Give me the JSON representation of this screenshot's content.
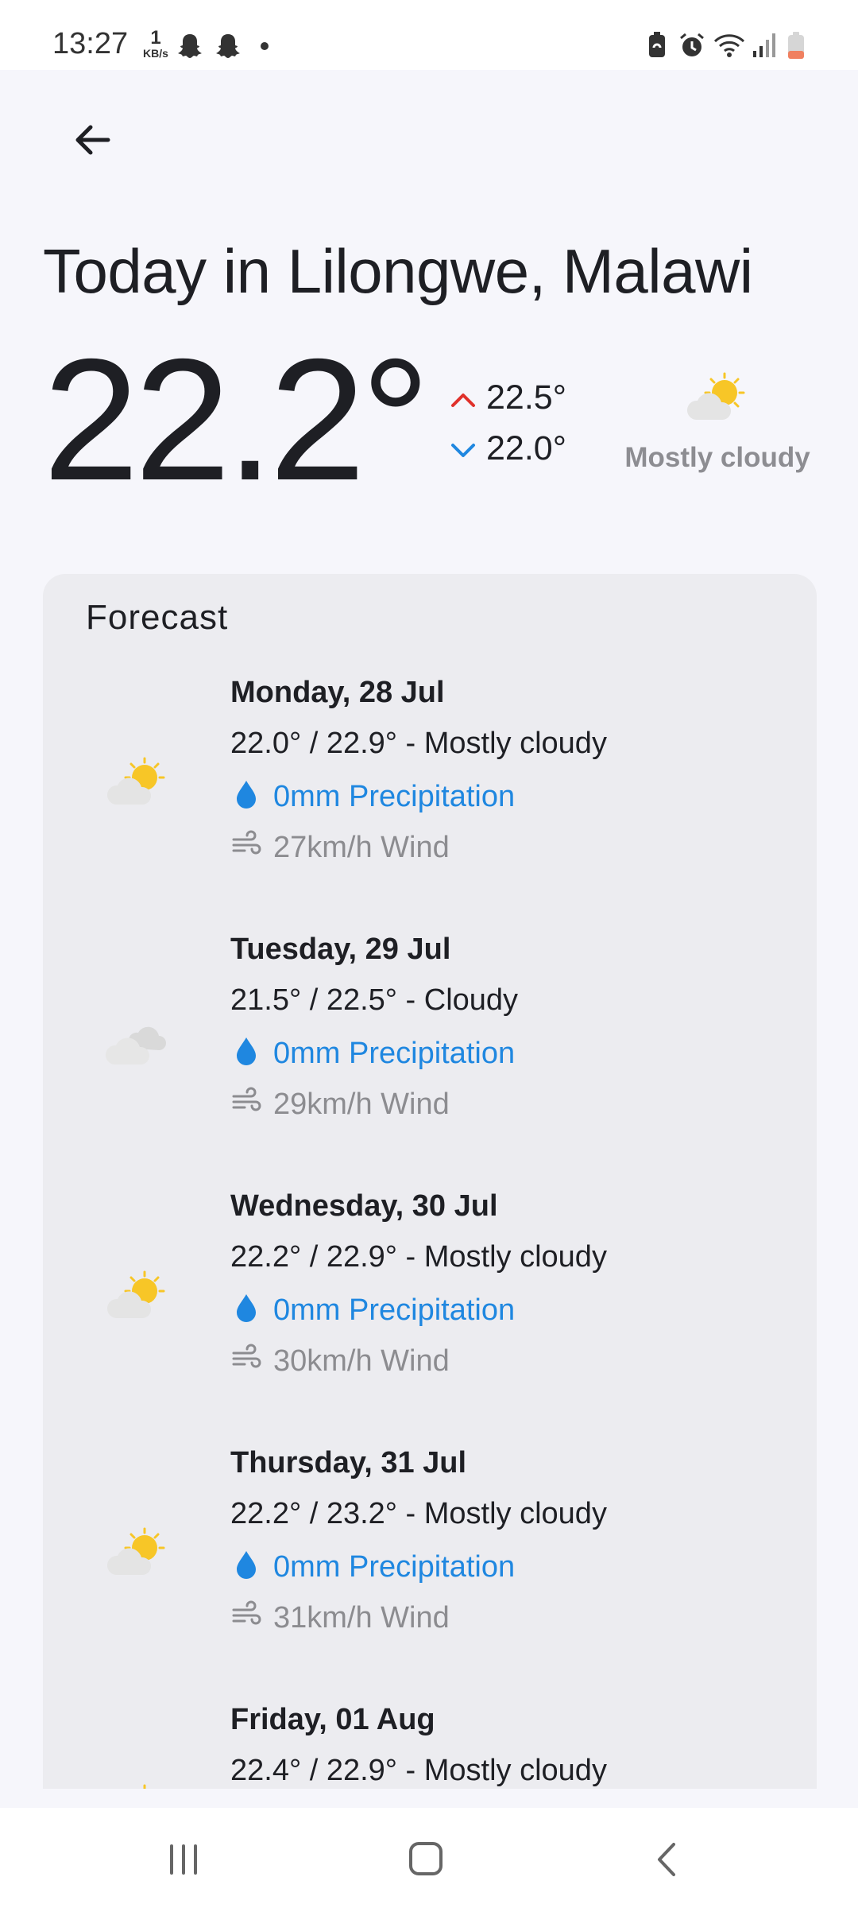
{
  "status_bar": {
    "time": "13:27",
    "speed_value": "1",
    "speed_unit": "KB/s",
    "left_icons": [
      "snapchat-ghost-icon",
      "snapchat-ghost-icon",
      "notification-dot-icon"
    ],
    "right_icons": [
      "battery-saver-icon",
      "alarm-icon",
      "wifi-icon",
      "signal-icon",
      "battery-icon"
    ]
  },
  "header": {
    "back_icon": "arrow-left-icon",
    "title": "Today in Lilongwe, Malawi"
  },
  "current": {
    "temperature": "22.2°",
    "high": "22.5°",
    "low": "22.0°",
    "condition": "Mostly cloudy",
    "condition_icon": "partly-cloudy-icon",
    "colors": {
      "high_arrow": "#e0312b",
      "low_arrow": "#1f87e0"
    }
  },
  "forecast": {
    "title": "Forecast",
    "days": [
      {
        "date": "Monday, 28 Jul",
        "summary": "22.0° / 22.9° - Mostly cloudy",
        "precipitation": "0mm Precipitation",
        "wind": "27km/h Wind",
        "icon": "partly-cloudy-icon"
      },
      {
        "date": "Tuesday, 29 Jul",
        "summary": "21.5° / 22.5° - Cloudy",
        "precipitation": "0mm Precipitation",
        "wind": "29km/h Wind",
        "icon": "cloudy-icon"
      },
      {
        "date": "Wednesday, 30 Jul",
        "summary": "22.2° / 22.9° - Mostly cloudy",
        "precipitation": "0mm Precipitation",
        "wind": "30km/h Wind",
        "icon": "partly-cloudy-icon"
      },
      {
        "date": "Thursday, 31 Jul",
        "summary": "22.2° / 23.2° - Mostly cloudy",
        "precipitation": "0mm Precipitation",
        "wind": "31km/h Wind",
        "icon": "partly-cloudy-icon"
      },
      {
        "date": "Friday, 01 Aug",
        "summary": "22.4° / 22.9° - Mostly cloudy",
        "precipitation": "",
        "wind": "",
        "icon": "partly-cloudy-icon"
      }
    ]
  },
  "nav_bar": {
    "buttons": [
      "recent-apps-icon",
      "home-icon",
      "back-icon"
    ]
  }
}
